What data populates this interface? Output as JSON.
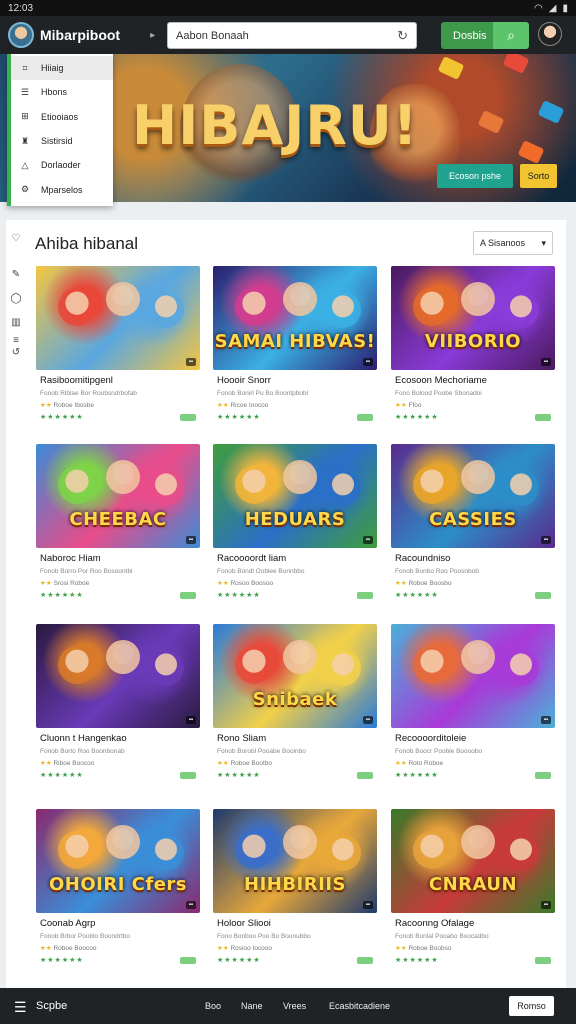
{
  "status_bar": {
    "time": "12:03"
  },
  "app_bar": {
    "brand": "Mibarpiboot",
    "caret": "▸",
    "search_value": "Aabon Bonaah",
    "download_label": "Dosbis"
  },
  "hero": {
    "title": "HIBAJRU!",
    "button_primary": "Ecoson pshe",
    "button_secondary": "Sorto"
  },
  "menu": {
    "items": [
      {
        "label": "Hiiaig",
        "icon": "controller-icon"
      },
      {
        "label": "Hbons",
        "icon": "list-icon"
      },
      {
        "label": "Etiooiaos",
        "icon": "puzzle-icon"
      },
      {
        "label": "Sistirsid",
        "icon": "trophy-icon"
      },
      {
        "label": "Dorlaoder",
        "icon": "download-icon"
      },
      {
        "label": "Mparselos",
        "icon": "settings-icon"
      }
    ]
  },
  "section": {
    "title": "Ahiba hibanal",
    "sort_label": "A Sisanoos"
  },
  "cards": [
    {
      "title": "Rasiboomitipgenl",
      "meta": "Fonob Riblae Bor Roubsndrbofab",
      "meta2": "Roboe Ibosbe",
      "stars": "★★★★★★",
      "thumb_text": "",
      "colors": [
        "#f4c542",
        "#e8473a",
        "#5aa7e0"
      ]
    },
    {
      "title": "Hoooir Snorr",
      "meta": "Fonob Bonirl Pu Bo Boontpbobl",
      "meta2": "Ricoe Inocoo",
      "stars": "★★★★★★",
      "thumb_text": "SAMAI HIBVAS!",
      "colors": [
        "#2b1e6e",
        "#d23c8f",
        "#3bb0e4"
      ]
    },
    {
      "title": "Ecosoon Mechoriame",
      "meta": "Fono Bolood Poobe Sbonadoi",
      "meta2": "Ffoo",
      "stars": "★★★★★★",
      "thumb_text": "VIIBORIO",
      "colors": [
        "#4a1a5e",
        "#e46a2a",
        "#8a3bd8"
      ]
    },
    {
      "title": "Naboroc Hiam",
      "meta": "Fonob Borro Por Roo Bosoontbi",
      "meta2": "Srosi Roboe",
      "stars": "★★★★★★",
      "thumb_text": "CHEEBAC",
      "colors": [
        "#3d8bd6",
        "#7ed348",
        "#e84c8a"
      ]
    },
    {
      "title": "Racoooordt liam",
      "meta": "Fonob Bondl Ooblee Bonnbbo",
      "meta2": "Rosoo Boosoo",
      "stars": "★★★★★★",
      "thumb_text": "HEDUARS",
      "colors": [
        "#3f9e3a",
        "#f0b53a",
        "#2a6fc8"
      ]
    },
    {
      "title": "Racoundniso",
      "meta": "Fonob Bonbo Roo Poosnbob",
      "meta2": "Roboe Boosbo",
      "stars": "★★★★★★",
      "thumb_text": "CASSIES",
      "colors": [
        "#5a2b8e",
        "#e8a52a",
        "#2c8ec8"
      ]
    },
    {
      "title": "Cluonn t Hangenkao",
      "meta": "Fonob Borto Roo Boonbonab",
      "meta2": "Riboe Boocoo",
      "stars": "★★★★★★",
      "thumb_text": "",
      "colors": [
        "#2a1a3e",
        "#d87a2a",
        "#6a3ab8"
      ]
    },
    {
      "title": "Rono Sliam",
      "meta": "Fonob Borobl Pooabe Booinbo",
      "meta2": "Roboe Bootbo",
      "stars": "★★★★★★",
      "thumb_text": "Snibaek",
      "colors": [
        "#2a7ad8",
        "#e84a3a",
        "#f2d04a"
      ]
    },
    {
      "title": "Recoooorditoleie",
      "meta": "Fonob Boocr Pooble Boooobo",
      "meta2": "Roto Roboe",
      "stars": "★★★★★★",
      "thumb_text": "",
      "colors": [
        "#4ab0d8",
        "#e86a3a",
        "#a83ad8"
      ]
    },
    {
      "title": "Coonab Agrp",
      "meta": "Fonob Brbor Pooblo Boondrtbo",
      "meta2": "Roboe Boocoo",
      "stars": "★★★★★★",
      "thumb_text": "OHOIRI Cfers",
      "colors": [
        "#8a2a6e",
        "#f2a83a",
        "#3a8ed8"
      ]
    },
    {
      "title": "Holoor Sliooi",
      "meta": "Fono Bonboo Poo Bo Boonubbo",
      "meta2": "Rosioo Iocooo",
      "stars": "★★★★★★",
      "thumb_text": "HIHBIRIIS",
      "colors": [
        "#1e3a6e",
        "#3a6ec8",
        "#e8a83a"
      ]
    },
    {
      "title": "Racoonng Ofalage",
      "meta": "Fonob Bonlal Pooabo Boocadbo",
      "meta2": "Roboe Boobso",
      "stars": "★★★★★★",
      "thumb_text": "CNRAUN",
      "colors": [
        "#3a7a2a",
        "#e8a23a",
        "#c83a3a"
      ]
    }
  ],
  "bottom_nav": {
    "brand": "Scpbe",
    "links": [
      "Boo",
      "Nane",
      "Vrees",
      "Ecasbitcadiene"
    ],
    "button": "Romso"
  }
}
